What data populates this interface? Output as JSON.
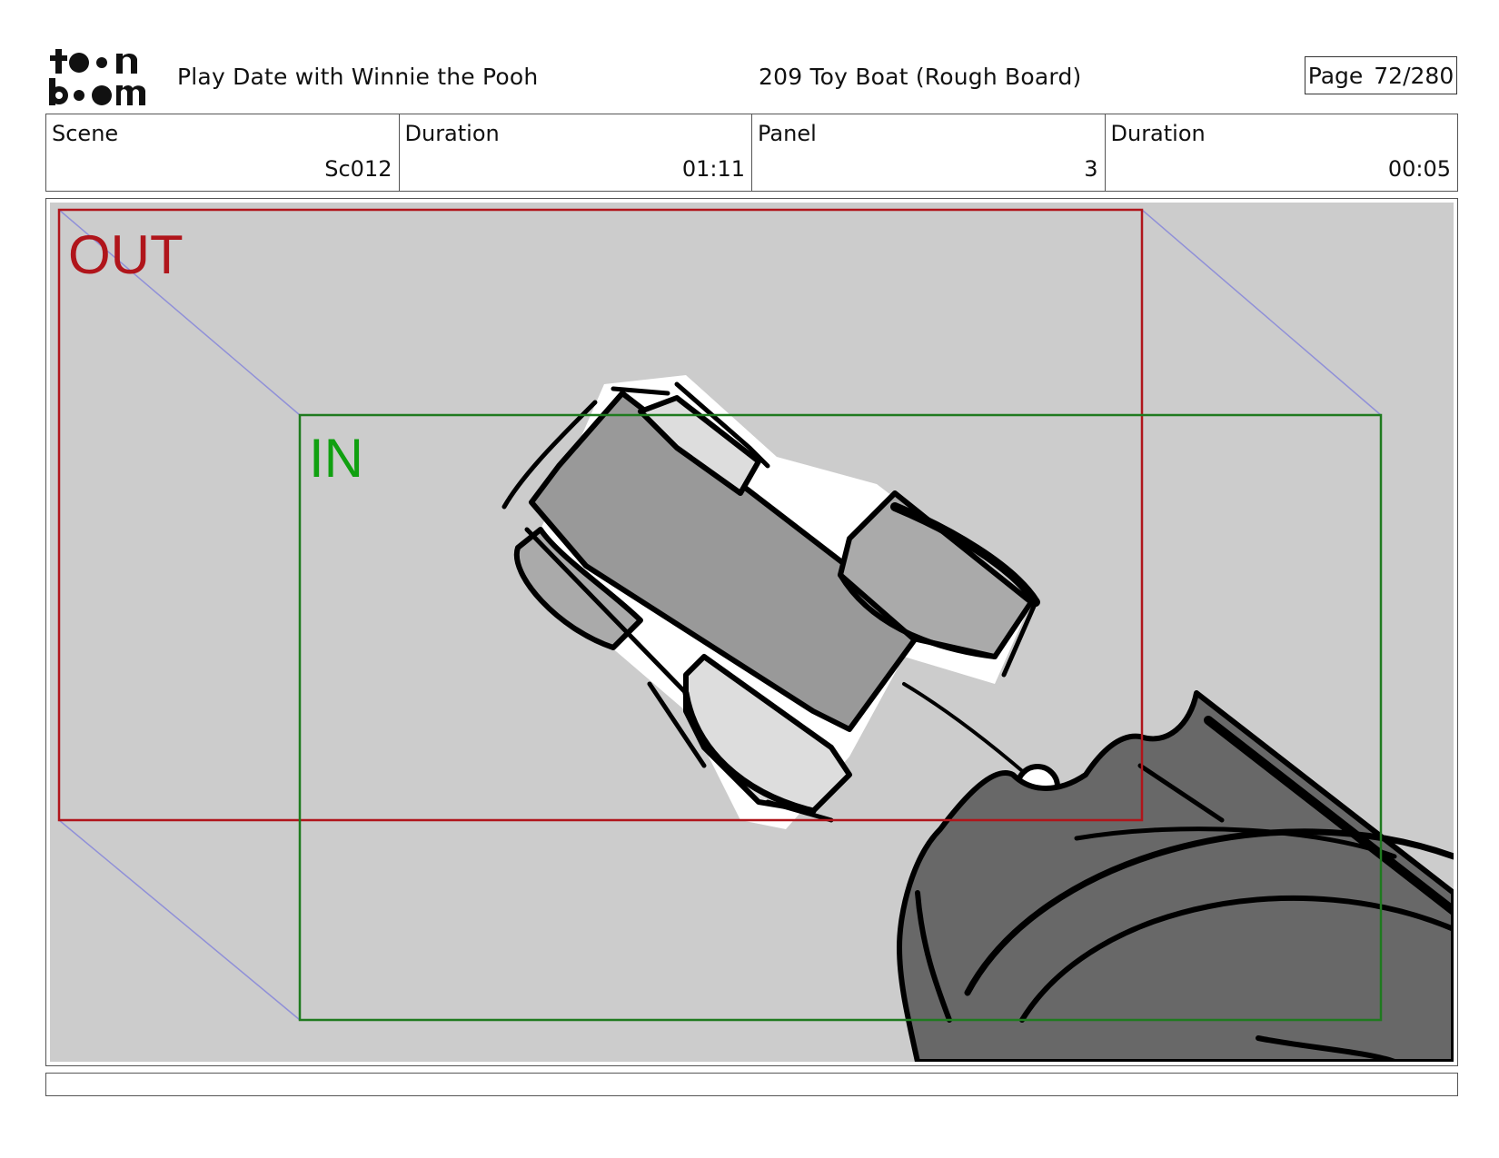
{
  "header": {
    "logo_text": [
      "to",
      "on",
      "bo",
      "om"
    ],
    "show_title": "Play Date with Winnie the Pooh",
    "episode_title": "209 Toy Boat (Rough Board)",
    "page_label": "Page",
    "page_number": "72/280"
  },
  "info": {
    "scene_label": "Scene",
    "scene_value": "Sc012",
    "scene_duration_label": "Duration",
    "scene_duration_value": "01:11",
    "panel_label": "Panel",
    "panel_value": "3",
    "panel_duration_label": "Duration",
    "panel_duration_value": "00:05"
  },
  "panel": {
    "out_label": "OUT",
    "in_label": "IN",
    "colors": {
      "out_frame": "#b0151b",
      "in_frame": "#1f7a1f",
      "in_text": "#10a010",
      "camera_path": "#9090d8",
      "background": "#cccccc",
      "mid_gray": "#999999",
      "dark_gray": "#686868"
    }
  },
  "notes": {
    "text": ""
  }
}
